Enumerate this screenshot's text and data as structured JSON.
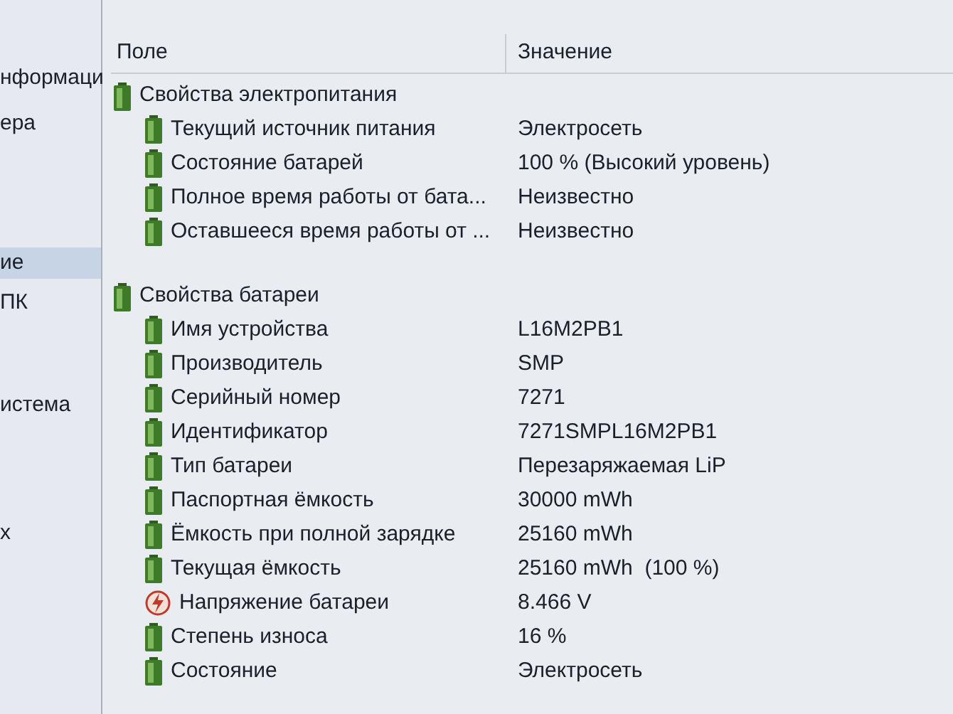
{
  "sidebar": {
    "items": [
      {
        "label": "нформаци",
        "selected": false
      },
      {
        "label": "ера",
        "selected": false
      },
      {
        "label": "ие",
        "selected": true
      },
      {
        "label": "ПК",
        "selected": false
      },
      {
        "label": "истема",
        "selected": false
      },
      {
        "label": "х",
        "selected": false
      }
    ]
  },
  "table": {
    "columns": [
      "Поле",
      "Значение"
    ],
    "groups": [
      {
        "title": "Свойства электропитания",
        "rows": [
          {
            "kind": "battery",
            "field": "Текущий источник питания",
            "value": "Электросеть"
          },
          {
            "kind": "battery",
            "field": "Состояние батарей",
            "value": "100 % (Высокий уровень)"
          },
          {
            "kind": "battery",
            "field": "Полное время работы от бата...",
            "value": "Неизвестно"
          },
          {
            "kind": "battery",
            "field": "Оставшееся время работы от ...",
            "value": "Неизвестно"
          }
        ]
      },
      {
        "title": "Свойства батареи",
        "rows": [
          {
            "kind": "battery",
            "field": "Имя устройства",
            "value": "L16M2PB1"
          },
          {
            "kind": "battery",
            "field": "Производитель",
            "value": "SMP"
          },
          {
            "kind": "battery",
            "field": "Серийный номер",
            "value": "7271"
          },
          {
            "kind": "battery",
            "field": "Идентификатор",
            "value": "7271SMPL16M2PB1"
          },
          {
            "kind": "battery",
            "field": "Тип батареи",
            "value": "Перезаряжаемая LiP"
          },
          {
            "kind": "battery",
            "field": "Паспортная ёмкость",
            "value": "30000 mWh"
          },
          {
            "kind": "battery",
            "field": "Ёмкость при полной зарядке",
            "value": "25160 mWh"
          },
          {
            "kind": "battery",
            "field": "Текущая ёмкость",
            "value": "25160 mWh  (100 %)"
          },
          {
            "kind": "voltage",
            "field": "Напряжение батареи",
            "value": "8.466 V"
          },
          {
            "kind": "battery",
            "field": "Степень износа",
            "value": "16 %"
          },
          {
            "kind": "battery",
            "field": "Состояние",
            "value": "Электросеть"
          }
        ]
      }
    ]
  }
}
